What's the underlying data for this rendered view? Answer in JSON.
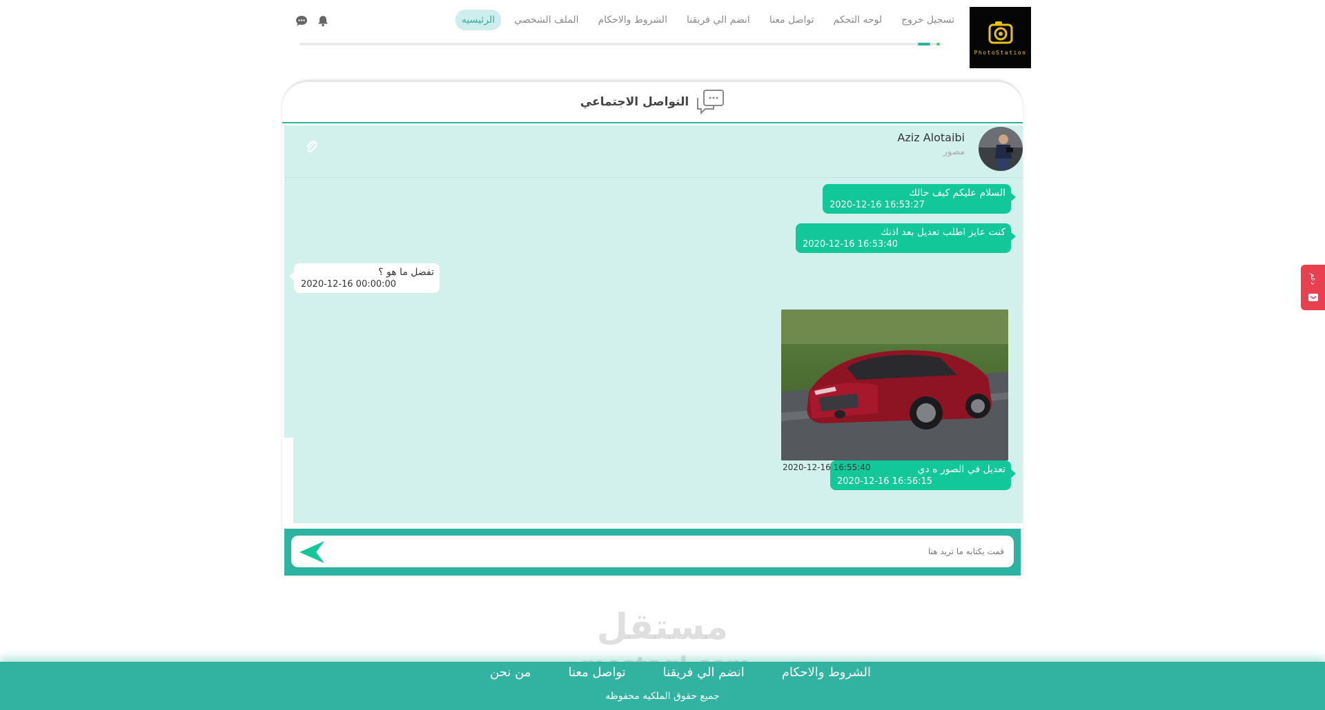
{
  "brand": {
    "logo_text": "PhotoStation",
    "accent": "#2cb3a1",
    "bubble_out_color": "#12c79a",
    "chat_bg": "#d2f1ed"
  },
  "nav": {
    "items": [
      {
        "label": "الرئيسيه",
        "active": true
      },
      {
        "label": "الملف الشخصي"
      },
      {
        "label": "الشروط والاحكام"
      },
      {
        "label": "انضم الي فريقنا"
      },
      {
        "label": "تواصل معنا"
      },
      {
        "label": "لوحه التحكم"
      },
      {
        "label": "تسجيل خروج"
      }
    ],
    "icons": [
      "bell-icon",
      "chat-icon"
    ]
  },
  "chat": {
    "title": "التواصل الاجتماعي",
    "contact": {
      "name": "Aziz Alotaibi",
      "role": "مصور"
    },
    "messages": [
      {
        "text": "السلام عليكم كيف حالك",
        "time": "2020-12-16 16:53:27",
        "direction": "out"
      },
      {
        "text": "كنت عايز اطلب تعديل بعد اذنك",
        "time": "2020-12-16 16:53:40",
        "direction": "out"
      },
      {
        "text": "تفضل ما هو ؟",
        "time": "2020-12-16 00:00:00",
        "direction": "in"
      },
      {
        "image": "red-sedan-photo",
        "time": "2020-12-16 16:55:40",
        "direction": "out"
      },
      {
        "text": "تعديل في الصور ه دي",
        "time": "2020-12-16 16:56:15",
        "direction": "out"
      }
    ],
    "input_placeholder": "قمت بكتابه ما تريد هنا"
  },
  "side_tab": {
    "label": "دعم"
  },
  "footer": {
    "links": [
      "الشروط والاحكام",
      "انضم الي فريقنا",
      "تواصل معنا",
      "من نحن"
    ],
    "copyright": "جميع حقوق الملكيه محفوظه"
  },
  "watermark": {
    "text": "مستقل",
    "sub": "mostaql.com"
  }
}
